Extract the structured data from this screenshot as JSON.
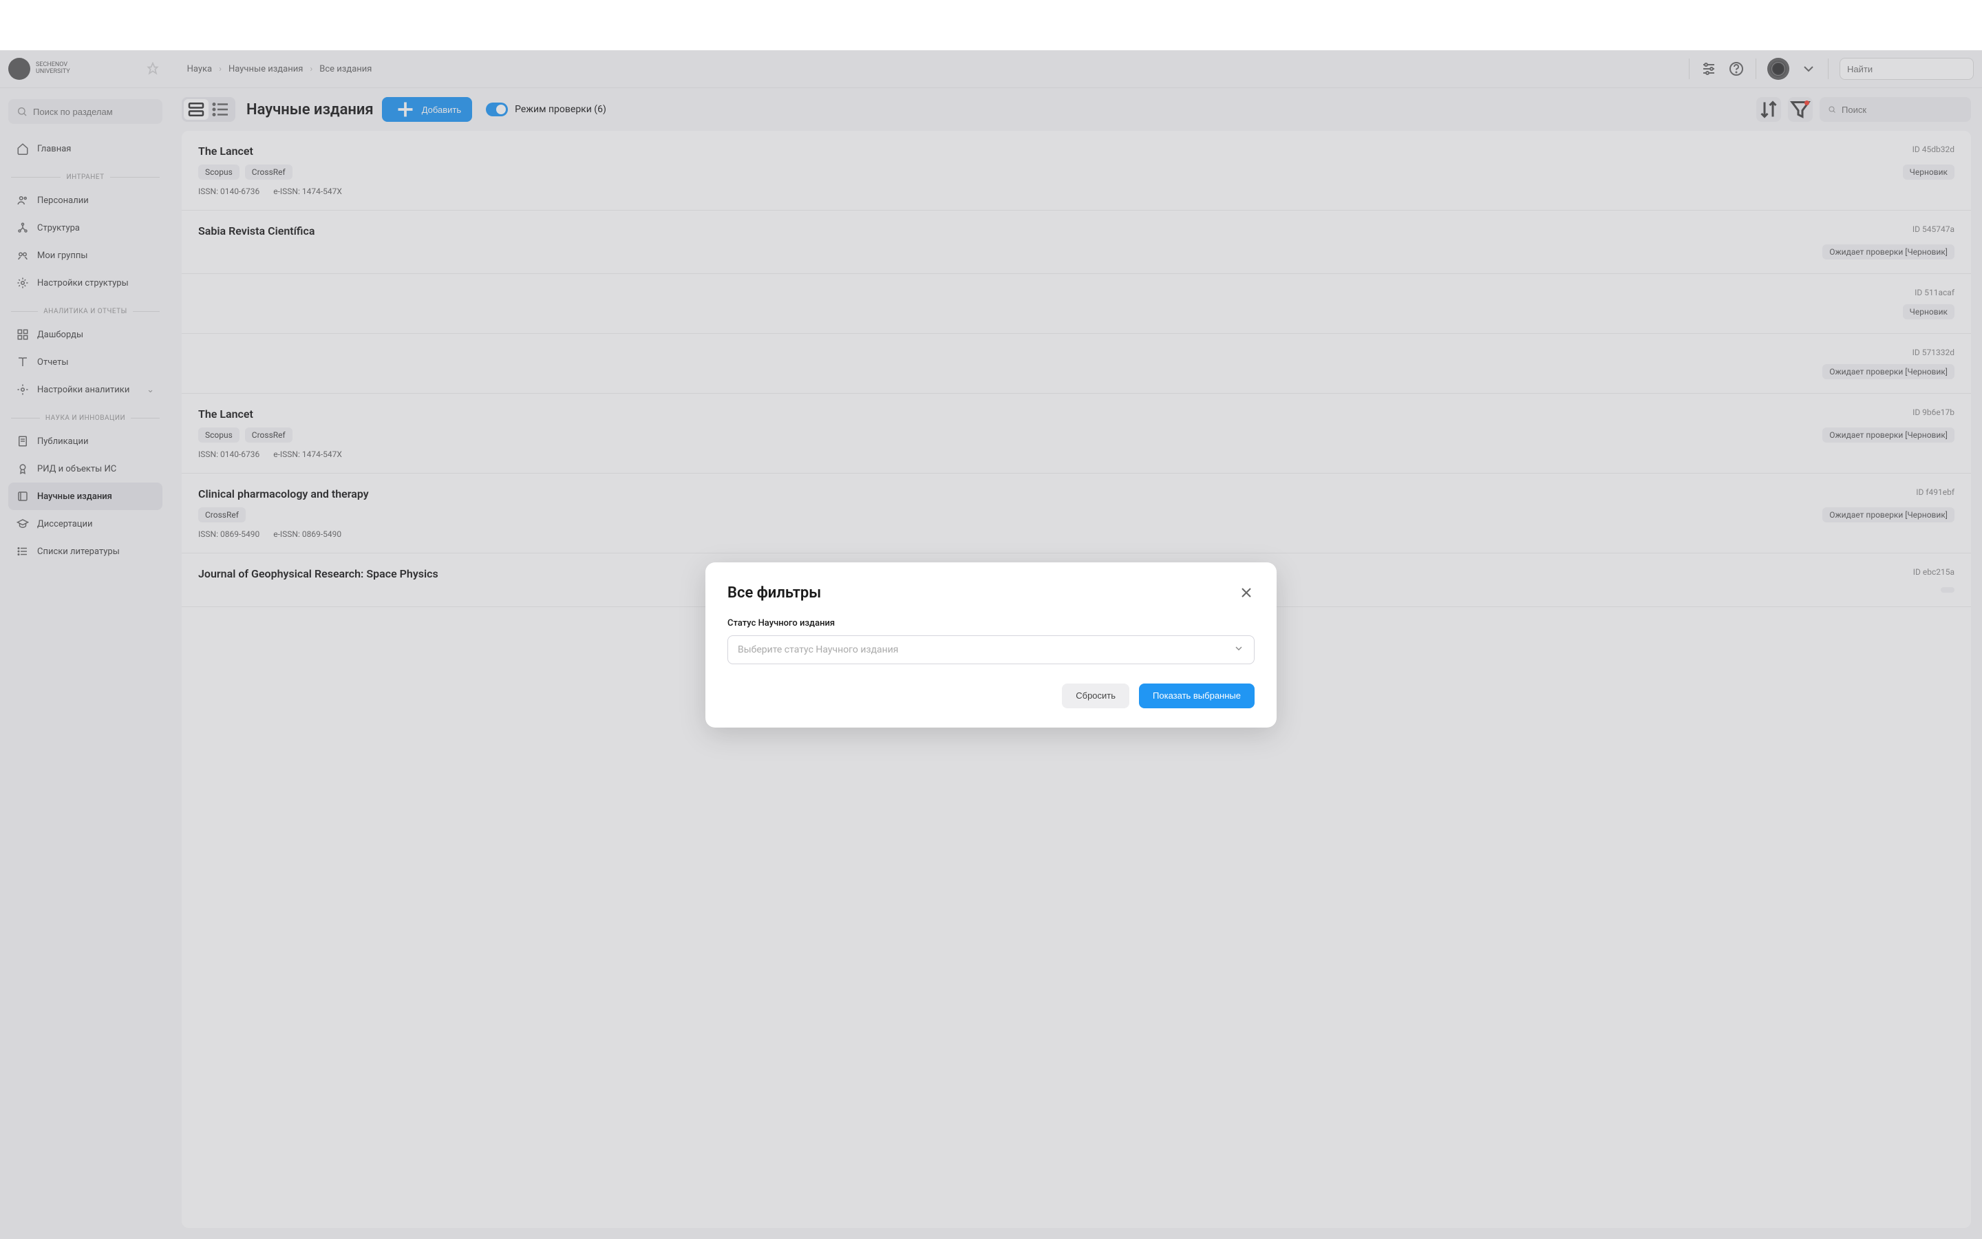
{
  "header": {
    "logo_line1": "SECHENOV",
    "logo_line2": "UNIVERSITY",
    "breadcrumbs": [
      "Наука",
      "Научные издания",
      "Все издания"
    ],
    "search_placeholder": "Найти"
  },
  "sidebar": {
    "search_placeholder": "Поиск по разделам",
    "home": "Главная",
    "sections": [
      {
        "title": "ИНТРАНЕТ",
        "items": [
          "Персоналии",
          "Структура",
          "Мои группы",
          "Настройки структуры"
        ]
      },
      {
        "title": "АНАЛИТИКА И ОТЧЕТЫ",
        "items": [
          "Дашборды",
          "Отчеты",
          "Настройки аналитики"
        ]
      },
      {
        "title": "НАУКА И ИННОВАЦИИ",
        "items": [
          "Публикации",
          "РИД и объекты ИС",
          "Научные издания",
          "Диссертации",
          "Списки литературы"
        ]
      }
    ]
  },
  "toolbar": {
    "title": "Научные издания",
    "add_label": "Добавить",
    "review_mode_label": "Режим проверки (6)",
    "search_placeholder": "Поиск"
  },
  "journals": [
    {
      "title": "The Lancet",
      "id": "ID 45db32d",
      "tags": [
        "Scopus",
        "CrossRef"
      ],
      "status": "Черновик",
      "issn": "ISSN: 0140-6736",
      "eissn": "e-ISSN: 1474-547X"
    },
    {
      "title": "Sabia Revista Científica",
      "id": "ID 545747a",
      "tags": [],
      "status": "Ожидает проверки [Черновик]",
      "issn": "",
      "eissn": ""
    },
    {
      "title": "",
      "id": "ID 511acaf",
      "tags": [],
      "status": "Черновик",
      "issn": "",
      "eissn": ""
    },
    {
      "title": "",
      "id": "ID 571332d",
      "tags": [],
      "status": "Ожидает проверки [Черновик]",
      "issn": "",
      "eissn": ""
    },
    {
      "title": "The Lancet",
      "id": "ID 9b6e17b",
      "tags": [
        "Scopus",
        "CrossRef"
      ],
      "status": "Ожидает проверки [Черновик]",
      "issn": "ISSN: 0140-6736",
      "eissn": "e-ISSN: 1474-547X"
    },
    {
      "title": "Clinical pharmacology and therapy",
      "id": "ID f491ebf",
      "tags": [
        "CrossRef"
      ],
      "status": "Ожидает проверки [Черновик]",
      "issn": "ISSN: 0869-5490",
      "eissn": "e-ISSN: 0869-5490"
    },
    {
      "title": "Journal of Geophysical Research: Space Physics",
      "id": "ID ebc215a",
      "tags": [],
      "status": "",
      "issn": "",
      "eissn": ""
    }
  ],
  "modal": {
    "title": "Все фильтры",
    "field_label": "Статус Научного издания",
    "select_placeholder": "Выберите статус Научного издания",
    "reset_label": "Сбросить",
    "apply_label": "Показать выбранные"
  }
}
